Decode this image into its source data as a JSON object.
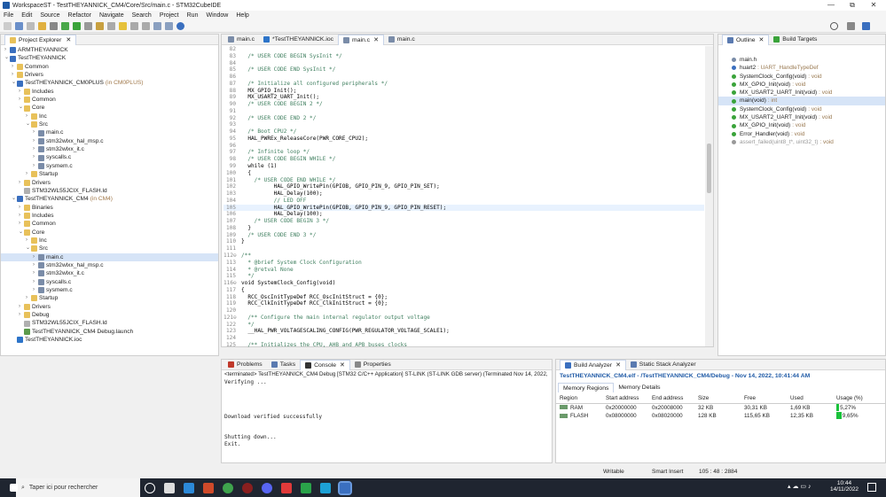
{
  "window": {
    "title": "WorkspaceST - TestTHEYANNICK_CM4/Core/Src/main.c - STM32CubeIDE",
    "minimize": "—",
    "maximize": "⧉",
    "close": "✕"
  },
  "menu": [
    "File",
    "Edit",
    "Source",
    "Refactor",
    "Navigate",
    "Search",
    "Project",
    "Run",
    "Window",
    "Help"
  ],
  "project_explorer": {
    "title": "Project Explorer",
    "items": [
      {
        "depth": 0,
        "tw": "›",
        "icon": "proj",
        "label": "ARMTHEYANNICK",
        "sub": ""
      },
      {
        "depth": 0,
        "tw": "⌄",
        "icon": "proj",
        "label": "TestTHEYANNICK",
        "sub": ""
      },
      {
        "depth": 1,
        "tw": "›",
        "icon": "folder",
        "label": "Common",
        "sub": ""
      },
      {
        "depth": 1,
        "tw": "›",
        "icon": "folder",
        "label": "Drivers",
        "sub": ""
      },
      {
        "depth": 1,
        "tw": "⌄",
        "icon": "proj",
        "label": "TestTHEYANNICK_CM0PLUS",
        "sub": "(in CM0PLUS)"
      },
      {
        "depth": 2,
        "tw": "›",
        "icon": "folder",
        "label": "Includes",
        "sub": ""
      },
      {
        "depth": 2,
        "tw": "›",
        "icon": "folder",
        "label": "Common",
        "sub": ""
      },
      {
        "depth": 2,
        "tw": "⌄",
        "icon": "folder",
        "label": "Core",
        "sub": ""
      },
      {
        "depth": 3,
        "tw": "›",
        "icon": "folder",
        "label": "Inc",
        "sub": ""
      },
      {
        "depth": 3,
        "tw": "⌄",
        "icon": "folder",
        "label": "Src",
        "sub": ""
      },
      {
        "depth": 4,
        "tw": "›",
        "icon": "file-c",
        "label": "main.c",
        "sub": ""
      },
      {
        "depth": 4,
        "tw": "›",
        "icon": "file-c",
        "label": "stm32wlxx_hal_msp.c",
        "sub": ""
      },
      {
        "depth": 4,
        "tw": "›",
        "icon": "file-c",
        "label": "stm32wlxx_it.c",
        "sub": ""
      },
      {
        "depth": 4,
        "tw": "›",
        "icon": "file-c",
        "label": "syscalls.c",
        "sub": ""
      },
      {
        "depth": 4,
        "tw": "›",
        "icon": "file-c",
        "label": "sysmem.c",
        "sub": ""
      },
      {
        "depth": 3,
        "tw": "›",
        "icon": "folder",
        "label": "Startup",
        "sub": ""
      },
      {
        "depth": 2,
        "tw": "›",
        "icon": "folder",
        "label": "Drivers",
        "sub": ""
      },
      {
        "depth": 2,
        "tw": "",
        "icon": "file-ld",
        "label": "STM32WL55JCIX_FLASH.ld",
        "sub": ""
      },
      {
        "depth": 1,
        "tw": "⌄",
        "icon": "proj",
        "label": "TestTHEYANNICK_CM4",
        "sub": "(in CM4)"
      },
      {
        "depth": 2,
        "tw": "›",
        "icon": "folder",
        "label": "Binaries",
        "sub": ""
      },
      {
        "depth": 2,
        "tw": "›",
        "icon": "folder",
        "label": "Includes",
        "sub": ""
      },
      {
        "depth": 2,
        "tw": "›",
        "icon": "folder",
        "label": "Common",
        "sub": ""
      },
      {
        "depth": 2,
        "tw": "⌄",
        "icon": "folder",
        "label": "Core",
        "sub": ""
      },
      {
        "depth": 3,
        "tw": "›",
        "icon": "folder",
        "label": "Inc",
        "sub": ""
      },
      {
        "depth": 3,
        "tw": "⌄",
        "icon": "folder",
        "label": "Src",
        "sub": ""
      },
      {
        "depth": 4,
        "tw": "›",
        "icon": "file-c",
        "label": "main.c",
        "sub": "",
        "selected": true
      },
      {
        "depth": 4,
        "tw": "›",
        "icon": "file-c",
        "label": "stm32wlxx_hal_msp.c",
        "sub": ""
      },
      {
        "depth": 4,
        "tw": "›",
        "icon": "file-c",
        "label": "stm32wlxx_it.c",
        "sub": ""
      },
      {
        "depth": 4,
        "tw": "›",
        "icon": "file-c",
        "label": "syscalls.c",
        "sub": ""
      },
      {
        "depth": 4,
        "tw": "›",
        "icon": "file-c",
        "label": "sysmem.c",
        "sub": ""
      },
      {
        "depth": 3,
        "tw": "›",
        "icon": "folder",
        "label": "Startup",
        "sub": ""
      },
      {
        "depth": 2,
        "tw": "›",
        "icon": "folder",
        "label": "Drivers",
        "sub": ""
      },
      {
        "depth": 2,
        "tw": "›",
        "icon": "folder",
        "label": "Debug",
        "sub": ""
      },
      {
        "depth": 2,
        "tw": "",
        "icon": "file-ld",
        "label": "STM32WL55JCIX_FLASH.ld",
        "sub": ""
      },
      {
        "depth": 2,
        "tw": "",
        "icon": "file-launch",
        "label": "TestTHEYANNICK_CM4 Debug.launch",
        "sub": ""
      },
      {
        "depth": 1,
        "tw": "",
        "icon": "file-ioc",
        "label": "TestTHEYANNICK.ioc",
        "sub": ""
      }
    ]
  },
  "editor": {
    "tabs": [
      {
        "label": "main.c",
        "active": false
      },
      {
        "label": "*TestTHEYANNICK.ioc",
        "active": false
      },
      {
        "label": "main.c",
        "active": true
      },
      {
        "label": "main.c",
        "active": false
      }
    ],
    "lines": [
      {
        "n": "82",
        "t": "",
        "c": false
      },
      {
        "n": "83",
        "t": "  /* USER CODE BEGIN SysInit */",
        "c": true
      },
      {
        "n": "84",
        "t": "",
        "c": false
      },
      {
        "n": "85",
        "t": "  /* USER CODE END SysInit */",
        "c": true
      },
      {
        "n": "86",
        "t": "",
        "c": false
      },
      {
        "n": "87",
        "t": "  /* Initialize all configured peripherals */",
        "c": true
      },
      {
        "n": "88",
        "t": "  MX_GPIO_Init();",
        "c": false
      },
      {
        "n": "89",
        "t": "  MX_USART2_UART_Init();",
        "c": false
      },
      {
        "n": "90",
        "t": "  /* USER CODE BEGIN 2 */",
        "c": true
      },
      {
        "n": "91",
        "t": "",
        "c": false
      },
      {
        "n": "92",
        "t": "  /* USER CODE END 2 */",
        "c": true
      },
      {
        "n": "93",
        "t": "",
        "c": false
      },
      {
        "n": "94",
        "t": "  /* Boot CPU2 */",
        "c": true
      },
      {
        "n": "95",
        "t": "  HAL_PWREx_ReleaseCore(PWR_CORE_CPU2);",
        "c": false
      },
      {
        "n": "96",
        "t": "",
        "c": false
      },
      {
        "n": "97",
        "t": "  /* Infinite loop */",
        "c": true
      },
      {
        "n": "98",
        "t": "  /* USER CODE BEGIN WHILE */",
        "c": true
      },
      {
        "n": "99",
        "t": "  while (1)",
        "c": false
      },
      {
        "n": "100",
        "t": "  {",
        "c": false
      },
      {
        "n": "101",
        "t": "    /* USER CODE END WHILE */",
        "c": true
      },
      {
        "n": "102",
        "t": "          HAL_GPIO_WritePin(GPIOB, GPIO_PIN_9, GPIO_PIN_SET);",
        "c": false
      },
      {
        "n": "103",
        "t": "          HAL_Delay(100);",
        "c": false
      },
      {
        "n": "104",
        "t": "          // LED OFF",
        "c": true
      },
      {
        "n": "105",
        "t": "          HAL_GPIO_WritePin(GPIOB, GPIO_PIN_9, GPIO_PIN_RESET);",
        "c": false,
        "hl": true
      },
      {
        "n": "106",
        "t": "          HAL_Delay(100);",
        "c": false
      },
      {
        "n": "107",
        "t": "    /* USER CODE BEGIN 3 */",
        "c": true
      },
      {
        "n": "108",
        "t": "  }",
        "c": false
      },
      {
        "n": "109",
        "t": "  /* USER CODE END 3 */",
        "c": true
      },
      {
        "n": "110",
        "t": "}",
        "c": false
      },
      {
        "n": "111",
        "t": "",
        "c": false
      },
      {
        "n": "112⊖",
        "t": "/**",
        "c": true
      },
      {
        "n": "113",
        "t": "  * @brief System Clock Configuration",
        "c": true
      },
      {
        "n": "114",
        "t": "  * @retval None",
        "c": true
      },
      {
        "n": "115",
        "t": "  */",
        "c": true
      },
      {
        "n": "116⊖",
        "t": "void SystemClock_Config(void)",
        "c": false
      },
      {
        "n": "117",
        "t": "{",
        "c": false
      },
      {
        "n": "118",
        "t": "  RCC_OscInitTypeDef RCC_OscInitStruct = {0};",
        "c": false
      },
      {
        "n": "119",
        "t": "  RCC_ClkInitTypeDef RCC_ClkInitStruct = {0};",
        "c": false
      },
      {
        "n": "120",
        "t": "",
        "c": false
      },
      {
        "n": "121⊖",
        "t": "  /** Configure the main internal regulator output voltage",
        "c": true
      },
      {
        "n": "122",
        "t": "  */",
        "c": true
      },
      {
        "n": "123",
        "t": "  __HAL_PWR_VOLTAGESCALING_CONFIG(PWR_REGULATOR_VOLTAGE_SCALE1);",
        "c": false
      },
      {
        "n": "124",
        "t": "",
        "c": false
      },
      {
        "n": "125",
        "t": "  /** Initializes the CPU, AHB and APB buses clocks",
        "c": true
      }
    ]
  },
  "outline": {
    "tabs": [
      "Outline",
      "Build Targets"
    ],
    "items": [
      {
        "label": "main.h",
        "type": "",
        "color": "#7a8ca8"
      },
      {
        "label": "huart2",
        "type": ": UART_HandleTypeDef",
        "color": "#3a6fbf"
      },
      {
        "label": "SystemClock_Config(void)",
        "type": ": void",
        "color": "#3aa33a"
      },
      {
        "label": "MX_GPIO_Init(void)",
        "type": ": void",
        "color": "#3aa33a"
      },
      {
        "label": "MX_USART2_UART_Init(void)",
        "type": ": void",
        "color": "#3aa33a"
      },
      {
        "label": "main(void)",
        "type": ": int",
        "color": "#3aa33a",
        "selected": true
      },
      {
        "label": "SystemClock_Config(void)",
        "type": ": void",
        "color": "#3aa33a"
      },
      {
        "label": "MX_USART2_UART_Init(void)",
        "type": ": void",
        "color": "#3aa33a"
      },
      {
        "label": "MX_GPIO_Init(void)",
        "type": ": void",
        "color": "#3aa33a"
      },
      {
        "label": "Error_Handler(void)",
        "type": ": void",
        "color": "#3aa33a"
      },
      {
        "label": "assert_failed(uint8_t*, uint32_t)",
        "type": ": void",
        "color": "#999999",
        "dim": true
      }
    ]
  },
  "console": {
    "tabs": [
      "Problems",
      "Tasks",
      "Console",
      "Properties"
    ],
    "header": "<terminated> TestTHEYANNICK_CM4 Debug [STM32 C/C++ Application] ST-LINK (ST-LINK GDB server) (Terminated Nov 14, 2022, 10:41:",
    "lines": [
      "Verifying ...",
      "",
      "",
      "",
      "",
      "Download verified successfully",
      "",
      "",
      "Shutting down...",
      "Exit."
    ]
  },
  "build_analyzer": {
    "tabs": [
      "Build Analyzer",
      "Static Stack Analyzer"
    ],
    "title": "TestTHEYANNICK_CM4.elf - /TestTHEYANNICK_CM4/Debug - Nov 14, 2022, 10:41:44 AM",
    "subtabs": [
      "Memory Regions",
      "Memory Details"
    ],
    "columns": [
      "Region",
      "Start address",
      "End address",
      "Size",
      "Free",
      "Used",
      "Usage (%)"
    ],
    "rows": [
      {
        "region": "RAM",
        "start": "0x20000000",
        "end": "0x20008000",
        "size": "32 KB",
        "free": "30,31 KB",
        "used": "1,69 KB",
        "usage": "5,27%",
        "pct": 5.27
      },
      {
        "region": "FLASH",
        "start": "0x08000000",
        "end": "0x08020000",
        "size": "128 KB",
        "free": "115,65 KB",
        "used": "12,35 KB",
        "usage": "9,65%",
        "pct": 9.65
      }
    ]
  },
  "statusbar": {
    "writable": "Writable",
    "insert": "Smart Insert",
    "position": "105 : 48 : 2884"
  },
  "taskbar": {
    "search": "Taper ici pour rechercher",
    "time": "10:44",
    "date": "14/11/2022"
  },
  "colors": {
    "accent": "#3a6fbf",
    "usage_bar": "#19c23a"
  }
}
